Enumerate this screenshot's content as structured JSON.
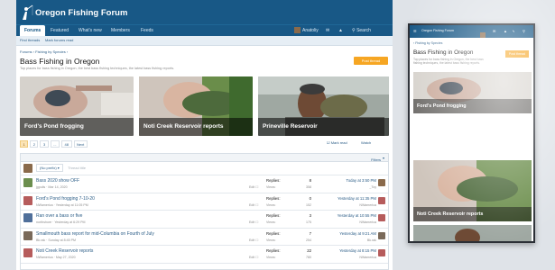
{
  "site": {
    "title": "Oregon Fishing Forum",
    "nav_tabs": [
      "Forums",
      "Featured",
      "What's new",
      "Members",
      "Feeds"
    ],
    "user": "Anatoliy",
    "search_label": "Search",
    "sub_links": [
      "Find threads",
      "Mark forums read"
    ]
  },
  "breadcrumb": [
    "Forums",
    "Fishing by Species"
  ],
  "page": {
    "title": "Bass Fishing in Oregon",
    "description": "Top places for bass fishing in Oregon, the best bass fishing techniques, the latest bass fishing reports.",
    "post_button": "Post thread"
  },
  "featured": [
    {
      "caption": "Ford's Pond frogging"
    },
    {
      "caption": "Noti Creek Reservoir reports"
    },
    {
      "caption": "Prineville Reservoir"
    }
  ],
  "pager": {
    "pages": [
      "1",
      "2",
      "3",
      "...",
      "48"
    ],
    "current": "1",
    "next": "Next"
  },
  "actions": {
    "mark_read": "Mark read",
    "watch": "Watch"
  },
  "filters_label": "Filters",
  "prefix_placeholder": "(No prefix)",
  "thread_title_placeholder": "Thread title",
  "threads": [
    {
      "title": "Bass 2020 show OFF",
      "author": "jgpulis",
      "started": "Mar 14, 2020",
      "replies": "8",
      "views": "358",
      "last_date": "Today at 3:50 PM",
      "last_user": "_Toy",
      "av_color": "#6b8e4e",
      "av2_color": "#8a6a4b"
    },
    {
      "title": "Ford's Pond frogging 7-10-20",
      "author": "NWamerica",
      "started": "Yesterday at 11:05 PM",
      "replies": "0",
      "views": "152",
      "last_date": "Yesterday at 11:35 PM",
      "last_user": "NWamerica",
      "av_color": "#b65c5c",
      "av2_color": "#b65c5c"
    },
    {
      "title": "Ran over a bass or five",
      "author": "northshore",
      "started": "Yesterday at 6:29 PM",
      "replies": "3",
      "views": "175",
      "last_date": "Yesterday at 10:55 PM",
      "last_user": "NWamerica",
      "av_color": "#4f6f9a",
      "av2_color": "#b65c5c"
    },
    {
      "title": "Smallmouth bass report for mid-Columbia on Fourth of July",
      "author": "Bk.rak",
      "started": "Sunday at 8:45 PM",
      "replies": "7",
      "views": "254",
      "last_date": "Yesterday at 9:21 AM",
      "last_user": "Bk.rak",
      "av_color": "#7a6a5a",
      "av2_color": "#7a6a5a"
    },
    {
      "title": "Noti Creek Reservoir reports",
      "author": "NWamerica",
      "started": "May 27, 2020",
      "replies": "22",
      "views": "780",
      "last_date": "Yesterday at 8:15 PM",
      "last_user": "NWamerica",
      "av_color": "#b65c5c",
      "av2_color": "#b65c5c"
    }
  ],
  "mobile": {
    "breadcrumb": "Fishing by Species",
    "title": "Bass Fishing in Oregon",
    "description": "Top places for bass fishing in Oregon, the best bass fishing techniques, the latest bass fishing reports.",
    "post_button": "Post thread",
    "captions": [
      "Ford's Pond frogging",
      "Noti Creek Reservoir reports"
    ]
  },
  "colors": {
    "brand": "#185886",
    "accent": "#f6a623",
    "link": "#2b5d87"
  }
}
